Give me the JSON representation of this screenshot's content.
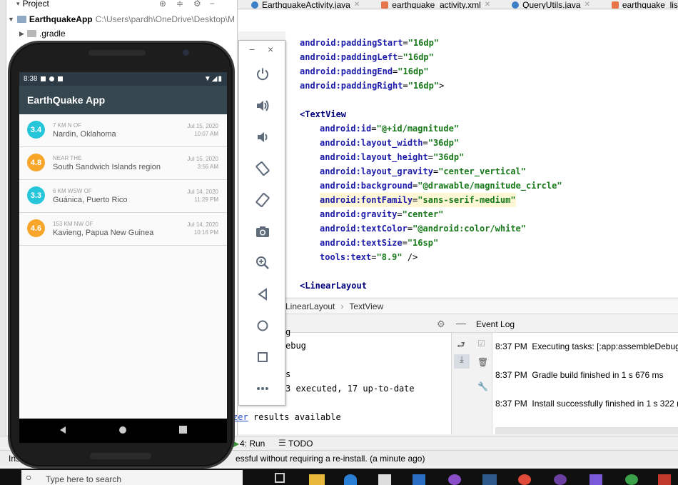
{
  "project_panel": {
    "title": "Project",
    "root_name": "EarthquakeApp",
    "root_path": "C:\\Users\\pardh\\OneDrive\\Desktop\\M",
    "child": ".gradle"
  },
  "editor_tabs": [
    {
      "label": "EarthquakeActivity.java",
      "icon_color": "#3d7fc6"
    },
    {
      "label": "earthquake_activity.xml",
      "icon_color": "#e8754a"
    },
    {
      "label": "QueryUtils.java",
      "icon_color": "#3d7fc6"
    },
    {
      "label": "earthquake_list.xml",
      "icon_color": "#e8754a"
    }
  ],
  "code": [
    {
      "indent": 1,
      "parts": [
        [
          "attr",
          "android:paddingStart"
        ],
        [
          "plain",
          "="
        ],
        [
          "val",
          "\"16dp\""
        ]
      ]
    },
    {
      "indent": 1,
      "parts": [
        [
          "attr",
          "android:paddingLeft"
        ],
        [
          "plain",
          "="
        ],
        [
          "val",
          "\"16dp\""
        ]
      ]
    },
    {
      "indent": 1,
      "parts": [
        [
          "attr",
          "android:paddingEnd"
        ],
        [
          "plain",
          "="
        ],
        [
          "val",
          "\"16dp\""
        ]
      ]
    },
    {
      "indent": 1,
      "parts": [
        [
          "attr",
          "android:paddingRight"
        ],
        [
          "plain",
          "="
        ],
        [
          "val",
          "\"16dp\""
        ],
        [
          "plain",
          ">"
        ]
      ]
    },
    {
      "indent": 0,
      "parts": []
    },
    {
      "indent": 1,
      "parts": [
        [
          "tag",
          "<TextView"
        ]
      ]
    },
    {
      "indent": 2,
      "parts": [
        [
          "attr",
          "android:id"
        ],
        [
          "plain",
          "="
        ],
        [
          "val",
          "\"@+id/magnitude\""
        ]
      ]
    },
    {
      "indent": 2,
      "parts": [
        [
          "attr",
          "android:layout_width"
        ],
        [
          "plain",
          "="
        ],
        [
          "val",
          "\"36dp\""
        ]
      ]
    },
    {
      "indent": 2,
      "parts": [
        [
          "attr",
          "android:layout_height"
        ],
        [
          "plain",
          "="
        ],
        [
          "val",
          "\"36dp\""
        ]
      ]
    },
    {
      "indent": 2,
      "parts": [
        [
          "attr",
          "android:layout_gravity"
        ],
        [
          "plain",
          "="
        ],
        [
          "val",
          "\"center_vertical\""
        ]
      ]
    },
    {
      "indent": 2,
      "parts": [
        [
          "attr",
          "android:background"
        ],
        [
          "plain",
          "="
        ],
        [
          "val",
          "\"@drawable/magnitude_circle\""
        ]
      ]
    },
    {
      "indent": 2,
      "parts": [
        [
          "attr",
          "android:fontFamily"
        ],
        [
          "plain",
          "="
        ],
        [
          "val",
          "\"sans-serif-medium\""
        ]
      ],
      "highlight": true
    },
    {
      "indent": 2,
      "parts": [
        [
          "attr",
          "android:gravity"
        ],
        [
          "plain",
          "="
        ],
        [
          "val",
          "\"center\""
        ]
      ]
    },
    {
      "indent": 2,
      "parts": [
        [
          "attr",
          "android:textColor"
        ],
        [
          "plain",
          "="
        ],
        [
          "val",
          "\"@android:color/white\""
        ]
      ]
    },
    {
      "indent": 2,
      "parts": [
        [
          "attr",
          "android:textSize"
        ],
        [
          "plain",
          "="
        ],
        [
          "val",
          "\"16sp\""
        ]
      ]
    },
    {
      "indent": 2,
      "parts": [
        [
          "attr",
          "tools:text"
        ],
        [
          "plain",
          "="
        ],
        [
          "val",
          "\"8.9\""
        ],
        [
          "plain",
          " />"
        ]
      ]
    },
    {
      "indent": 0,
      "parts": []
    },
    {
      "indent": 1,
      "parts": [
        [
          "tag",
          "<LinearLayout"
        ]
      ]
    }
  ],
  "breadcrumb": {
    "items": [
      "LinearLayout",
      "TextView"
    ],
    "separator": "›"
  },
  "run_panel": {
    "lines": [
      "g",
      "ebug",
      "",
      "s",
      "3 executed, 17 up-to-date",
      "",
      "zer results available"
    ],
    "link_text": "zer"
  },
  "event_log": {
    "title": "Event Log",
    "entries": [
      {
        "time": "8:37 PM",
        "text": "Executing tasks: [:app:assembleDebug]"
      },
      {
        "time": "8:37 PM",
        "text": "Gradle build finished in 1 s 676 ms"
      },
      {
        "time": "8:37 PM",
        "text": "Install successfully finished in 1 s 322 m"
      }
    ]
  },
  "bottom_tools": {
    "run_label": "4: Run",
    "todo_label": "TODO"
  },
  "status_bar": {
    "left": "Ins",
    "message": "essful without requiring a re-install. (a minute ago)"
  },
  "taskbar": {
    "search_placeholder": "Type here to search"
  },
  "emulator_toolbar": {
    "minimize": "−",
    "close": "×",
    "buttons": [
      "power-icon",
      "volume-up-icon",
      "volume-down-icon",
      "rotate-left-icon",
      "rotate-right-icon",
      "camera-icon",
      "zoom-icon",
      "back-icon",
      "home-icon",
      "overview-icon",
      "more-icon"
    ]
  },
  "phone": {
    "status_time": "8:38",
    "app_title": "EarthQuake App",
    "quakes": [
      {
        "mag": "3.4",
        "color": "#26c6da",
        "offset": "7 KM N OF",
        "place": "Nardin, Oklahoma",
        "date": "Jul 15, 2020",
        "time": "10:07 AM"
      },
      {
        "mag": "4.8",
        "color": "#f7a629",
        "offset": "NEAR THE",
        "place": "South Sandwich Islands region",
        "date": "Jul 15, 2020",
        "time": "3:56 AM"
      },
      {
        "mag": "3.3",
        "color": "#26c6da",
        "offset": "6 KM WSW OF",
        "place": "Guánica, Puerto Rico",
        "date": "Jul 14, 2020",
        "time": "11:29 PM"
      },
      {
        "mag": "4.6",
        "color": "#f7a629",
        "offset": "153 KM NW OF",
        "place": "Kavieng, Papua New Guinea",
        "date": "Jul 14, 2020",
        "time": "10:16 PM"
      }
    ]
  }
}
